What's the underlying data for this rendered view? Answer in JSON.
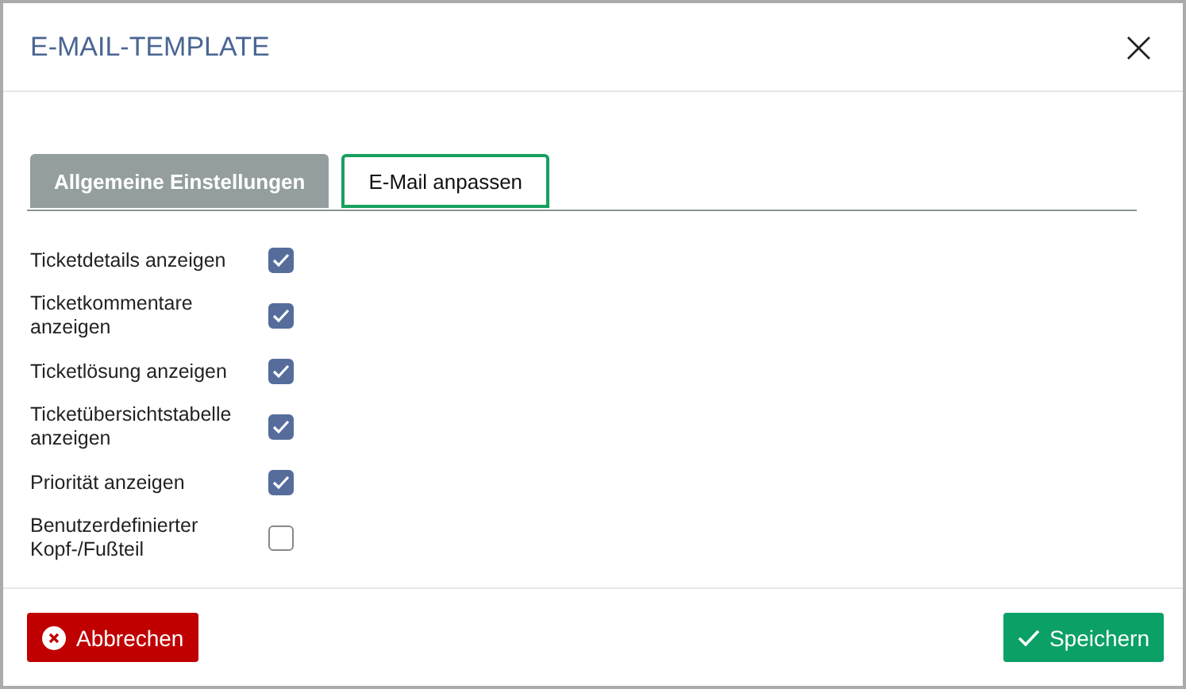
{
  "dialog": {
    "title": "E-MAIL-TEMPLATE",
    "close": "×"
  },
  "tabs": [
    {
      "label": "Allgemeine Einstellungen",
      "selected": false
    },
    {
      "label": "E-Mail anpassen",
      "selected": true
    }
  ],
  "options": [
    {
      "label": "Ticketdetails anzeigen",
      "checked": true
    },
    {
      "label": "Ticketkommentare anzeigen",
      "checked": true
    },
    {
      "label": "Ticketlösung anzeigen",
      "checked": true
    },
    {
      "label": "Ticketübersichtstabelle anzeigen",
      "checked": true
    },
    {
      "label": "Priorität anzeigen",
      "checked": true
    },
    {
      "label": "Benutzerdefinierter Kopf-/Fußteil",
      "checked": false
    }
  ],
  "buttons": [
    {
      "label": "Abbrechen",
      "kind": "cancel"
    },
    {
      "label": "Speichern",
      "kind": "save"
    }
  ]
}
